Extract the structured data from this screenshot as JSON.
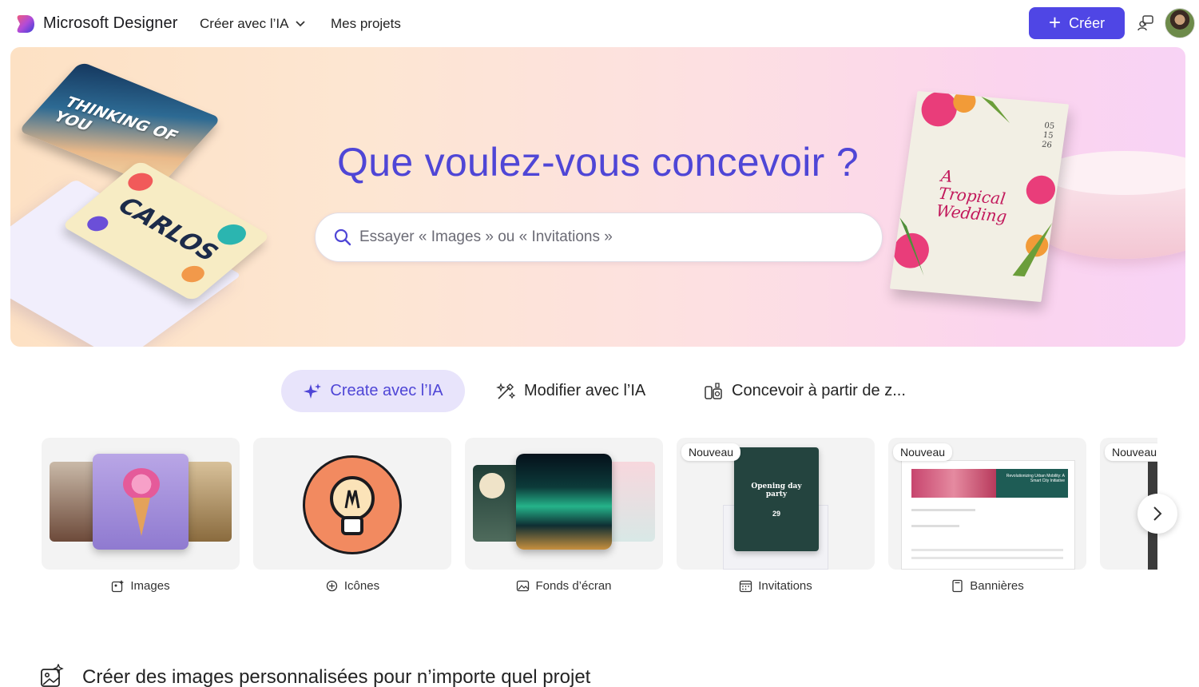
{
  "app": {
    "brand": "Microsoft Designer"
  },
  "nav": {
    "create_ai": "Créer avec l’IA",
    "projects": "Mes projets"
  },
  "header": {
    "create_button": "Créer"
  },
  "hero": {
    "title": "Que voulez-vous concevoir ?",
    "search_placeholder": "Essayer « Images » ou « Invitations »",
    "deco": {
      "card1": "THINKING OF YOU",
      "card2": "CARLOS",
      "invite_title": "A Tropical Wedding",
      "invite_date": "05\n15\n26"
    }
  },
  "tabs": [
    {
      "label": "Create avec l’IA",
      "active": true
    },
    {
      "label": "Modifier avec l’IA",
      "active": false
    },
    {
      "label": "Concevoir à partir de z...",
      "active": false
    }
  ],
  "categories": [
    {
      "label": "Images",
      "badge": "",
      "icon": "image-sparkle-icon"
    },
    {
      "label": "Icônes",
      "badge": "",
      "icon": "icon-shapes-icon"
    },
    {
      "label": "Fonds d’écran",
      "badge": "",
      "icon": "wallpaper-icon"
    },
    {
      "label": "Invitations",
      "badge": "Nouveau",
      "icon": "calendar-icon",
      "thumb_text": "Opening day party",
      "thumb_date": "29"
    },
    {
      "label": "Bannières",
      "badge": "Nouveau",
      "icon": "document-icon",
      "thumb_text": "Revolutionizing Urban Mobility: A Smart City Initiative"
    },
    {
      "label": "",
      "badge": "Nouveau",
      "icon": ""
    }
  ],
  "section": {
    "title": "Créer des images personnalisées pour n’importe quel projet"
  },
  "colors": {
    "accent": "#4f46e5",
    "hero_title": "#4f46d6",
    "tab_active_bg": "#e8e4fb"
  }
}
